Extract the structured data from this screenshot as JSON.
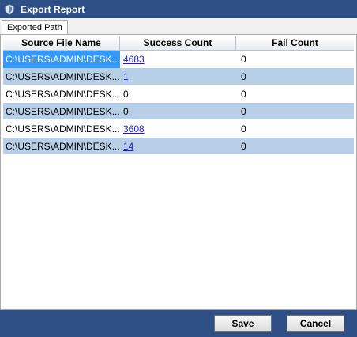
{
  "window": {
    "title": "Export Report"
  },
  "tabs": [
    {
      "label": "Exported Path"
    }
  ],
  "table": {
    "columns": [
      "Source File Name",
      "Success Count",
      "Fail Count"
    ],
    "rows": [
      {
        "source": "C:\\USERS\\ADMIN\\DESK...",
        "success": "4683",
        "fail": "0"
      },
      {
        "source": "C:\\USERS\\ADMIN\\DESK...",
        "success": "1",
        "fail": "0"
      },
      {
        "source": "C:\\USERS\\ADMIN\\DESK...",
        "success": "0",
        "fail": "0"
      },
      {
        "source": "C:\\USERS\\ADMIN\\DESK...",
        "success": "0",
        "fail": "0"
      },
      {
        "source": "C:\\USERS\\ADMIN\\DESK...",
        "success": "3608",
        "fail": "0"
      },
      {
        "source": "C:\\USERS\\ADMIN\\DESK...",
        "success": "14",
        "fail": "0"
      }
    ]
  },
  "buttons": {
    "save": "Save",
    "cancel": "Cancel"
  },
  "colors": {
    "titlebar": "#2d4f86",
    "row_alt": "#b8cfe8",
    "selection": "#3399ff",
    "link": "#1a1adb"
  }
}
